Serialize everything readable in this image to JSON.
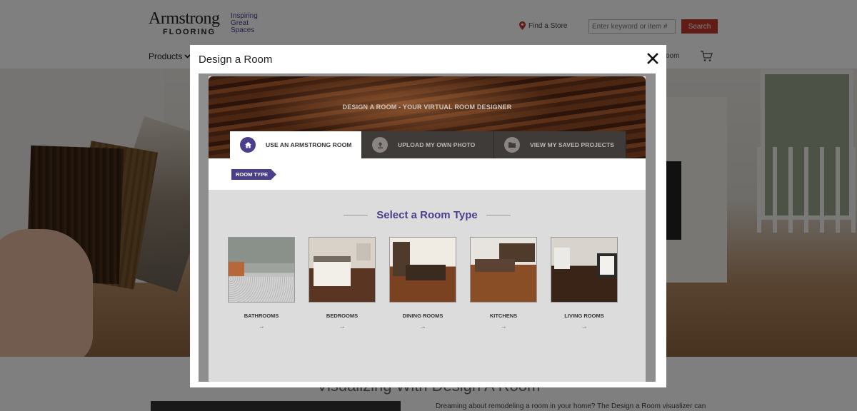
{
  "site": {
    "logo_main": "Armstrong",
    "logo_sub": "FLOORING",
    "tagline": "Inspiring Great Spaces",
    "find_store": "Find a Store",
    "search_placeholder": "Enter keyword or item #",
    "search_button": "Search",
    "nav_products": "Products",
    "nav_room_partial": "oom",
    "below_title": "Visualizing With Design A Room",
    "below_text": "Dreaming about remodeling a room in your home? The Design a Room visualizer can"
  },
  "modal": {
    "title": "Design a Room",
    "banner_title": "DESIGN A ROOM - YOUR VIRTUAL ROOM DESIGNER",
    "tabs": [
      {
        "label": "USE AN ARMSTRONG ROOM",
        "icon": "home-icon",
        "active": true
      },
      {
        "label": "UPLOAD MY OWN PHOTO",
        "icon": "upload-icon",
        "active": false
      },
      {
        "label": "VIEW MY SAVED PROJECTS",
        "icon": "folder-icon",
        "active": false
      }
    ],
    "step_tag": "ROOM TYPE",
    "section_heading": "Select a Room Type",
    "rooms": [
      {
        "label": "BATHROOMS",
        "arrow": "→"
      },
      {
        "label": "BEDROOMS",
        "arrow": "→"
      },
      {
        "label": "DINING ROOMS",
        "arrow": "→"
      },
      {
        "label": "KITCHENS",
        "arrow": "→"
      },
      {
        "label": "LIVING ROOMS",
        "arrow": "→"
      }
    ]
  },
  "colors": {
    "brand_purple": "#4b3f8c",
    "search_red": "#c0392b",
    "overlay": "rgba(0,0,0,0.5)"
  }
}
